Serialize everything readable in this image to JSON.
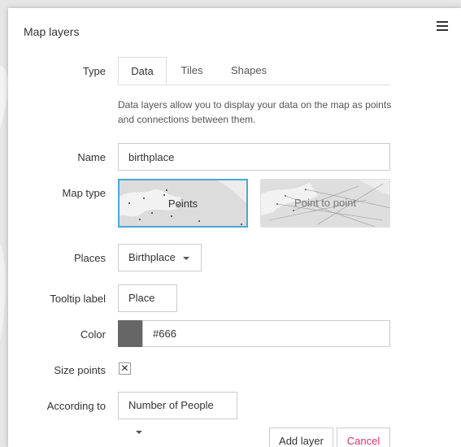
{
  "panel": {
    "title": "Map layers"
  },
  "labels": {
    "type": "Type",
    "name": "Name",
    "map_type": "Map type",
    "places": "Places",
    "tooltip_label": "Tooltip label",
    "color": "Color",
    "size_points": "Size points",
    "according_to": "According to"
  },
  "tabs": [
    {
      "label": "Data",
      "active": true
    },
    {
      "label": "Tiles",
      "active": false
    },
    {
      "label": "Shapes",
      "active": false
    }
  ],
  "description": "Data layers allow you to display your data on the map as points and connections between them.",
  "name_field": {
    "value": "birthplace"
  },
  "map_types": [
    {
      "label": "Points",
      "selected": true
    },
    {
      "label": "Point to point",
      "selected": false
    }
  ],
  "places_select": {
    "value": "Birthplace"
  },
  "tooltip_select": {
    "value": "Place"
  },
  "color_field": {
    "value": "#666",
    "swatch": "#666666"
  },
  "size_points": {
    "checked": true,
    "mark": "✕"
  },
  "according_select": {
    "value": "Number of People"
  },
  "buttons": {
    "add": "Add layer",
    "cancel": "Cancel"
  },
  "colors": {
    "accent": "#4aa8d8",
    "cancel": "#d6336c"
  }
}
